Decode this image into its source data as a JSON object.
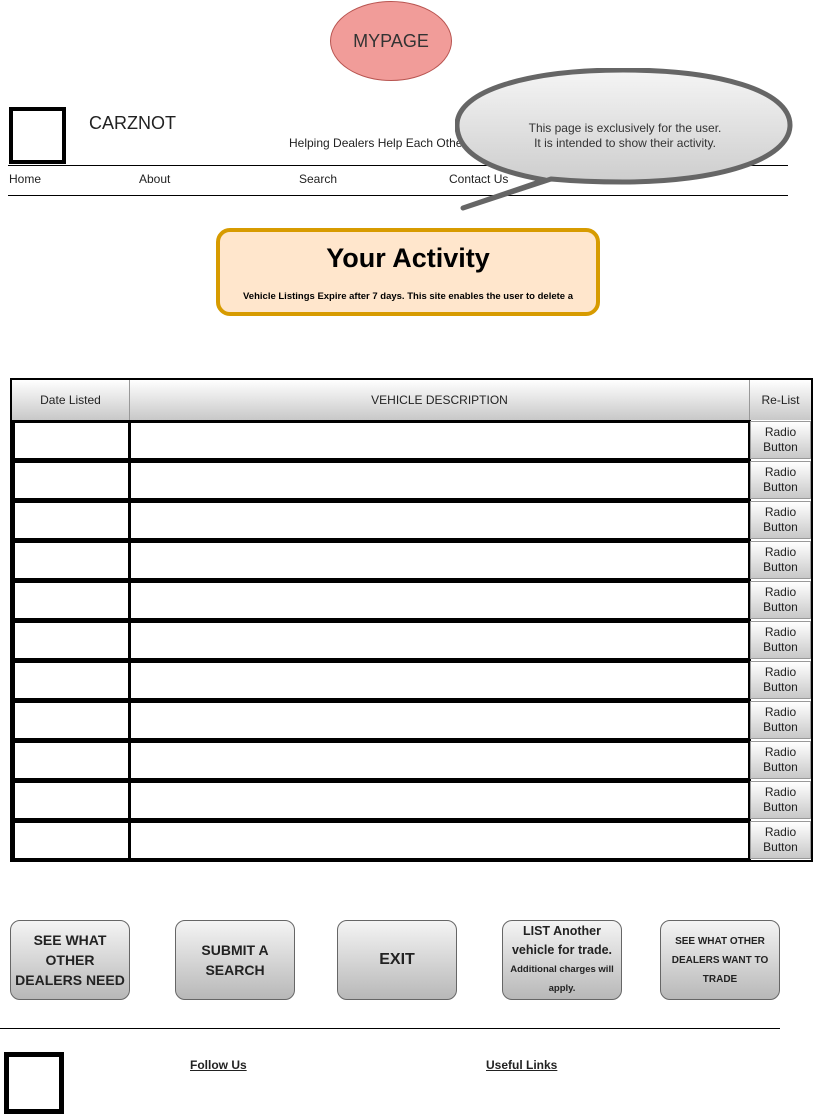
{
  "page_badge": "MYPAGE",
  "header": {
    "brand": "CARZNOT",
    "tagline": "Helping Dealers Help Each Other"
  },
  "nav": {
    "items": [
      "Home",
      "About",
      "Search",
      "Contact Us"
    ]
  },
  "callout": {
    "line1": "This page is exclusively for the user.",
    "line2": "It is intended to show their activity."
  },
  "activity": {
    "title": "Your Activity",
    "subtitle": "Vehicle Listings Expire after 7 days. This site enables the user to delete a"
  },
  "table": {
    "headers": [
      "Date Listed",
      "VEHICLE DESCRIPTION",
      "Re-List"
    ],
    "row_action_line1": "Radio",
    "row_action_line2": "Button",
    "row_count": 11
  },
  "buttons": {
    "see_needs": "SEE WHAT OTHER DEALERS NEED",
    "submit_search": "SUBMIT A SEARCH",
    "exit": "EXIT",
    "list_another_main": "LIST Another vehicle for trade.",
    "list_another_note": "Additional charges will apply.",
    "see_trades": "SEE WHAT OTHER DEALERS WANT TO TRADE"
  },
  "footer": {
    "follow_us": "Follow Us",
    "useful_links": "Useful Links"
  },
  "colors": {
    "badge_fill": "#f19c99",
    "activity_fill": "#ffe6cc",
    "activity_border": "#d79b00",
    "callout_fill": "#d8d8d8",
    "callout_border": "#666666"
  }
}
